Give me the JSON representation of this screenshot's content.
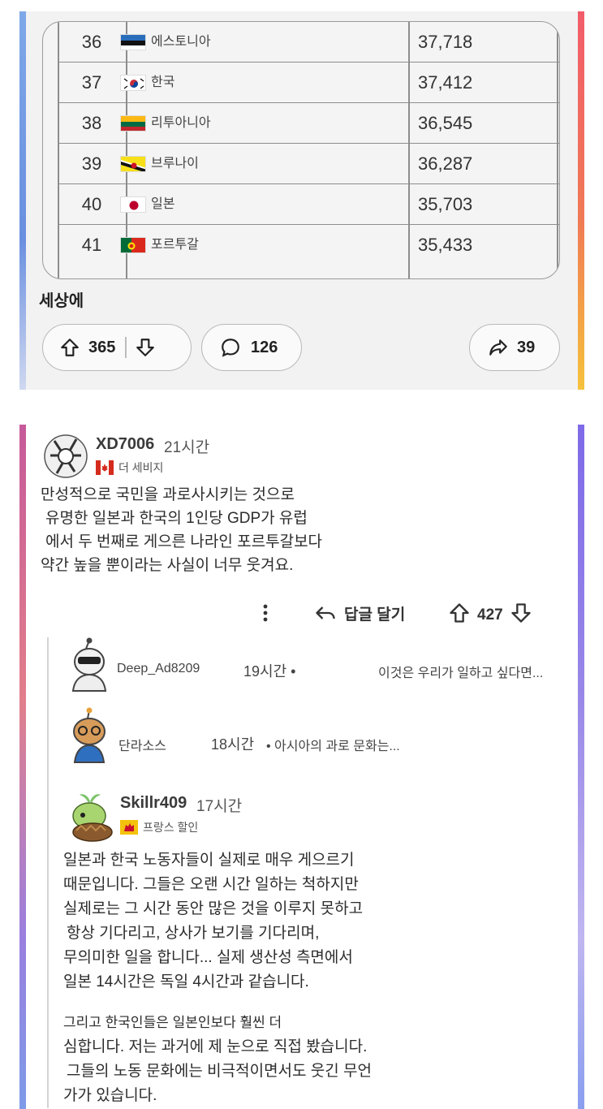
{
  "gdp_table": {
    "rows": [
      {
        "rank": "36",
        "country": "에스토니아",
        "gdp": "37,718",
        "flag": "estonia-flag"
      },
      {
        "rank": "37",
        "country": "한국",
        "gdp": "37,412",
        "flag": "korea-flag"
      },
      {
        "rank": "38",
        "country": "리투아니아",
        "gdp": "36,545",
        "flag": "lithuania-flag"
      },
      {
        "rank": "39",
        "country": "브루나이",
        "gdp": "36,287",
        "flag": "brunei-flag"
      },
      {
        "rank": "40",
        "country": "일본",
        "gdp": "35,703",
        "flag": "japan-flag"
      },
      {
        "rank": "41",
        "country": "포르투갈",
        "gdp": "35,433",
        "flag": "portugal-flag"
      }
    ]
  },
  "post": {
    "footer_text": "세상에",
    "upvotes": "365",
    "comments": "126",
    "shares": "39"
  },
  "comment_main": {
    "username": "XD7006",
    "time": "21시간",
    "flair": "더 세비지",
    "lines": [
      "만성적으로 국민을 과로사시키는 것으로",
      "유명한 일본과 한국의 1인당 GDP가 유럽",
      "에서 두 번째로 게으른 나라인 포르투갈보다",
      "약간 높을 뿐이라는 사실이 너무 웃겨요."
    ],
    "reply_label": "답글 달기",
    "votes": "427"
  },
  "collapsed_replies": [
    {
      "username": "Deep_Ad8209",
      "time": "19시간 •",
      "preview": "이것은 우리가 일하고 싶다면..."
    },
    {
      "username": "단라소스",
      "time": "18시간",
      "preview": "• 아시아의 과로 문화는..."
    }
  ],
  "comment_reply": {
    "username": "Skillr409",
    "time": "17시간",
    "flair": "프랑스 할인",
    "paragraph1": [
      "일본과 한국 노동자들이 실제로 매우 게으르기",
      "때문입니다. 그들은 오랜 시간 일하는 척하지만",
      "실제로는 그 시간 동안 많은 것을 이루지 못하고",
      "항상 기다리고, 상사가 보기를 기다리며,",
      "무의미한 일을 합니다... 실제 생산성 측면에서",
      "일본 14시간은 독일 4시간과 같습니다."
    ],
    "paragraph2": [
      "그리고 한국인들은 일본인보다 훨씬 더",
      "심합니다. 저는 과거에 제 눈으로 직접 봤습니다.",
      "그들의 노동 문화에는 비극적이면서도 웃긴 무언",
      "가가 있습니다."
    ]
  }
}
